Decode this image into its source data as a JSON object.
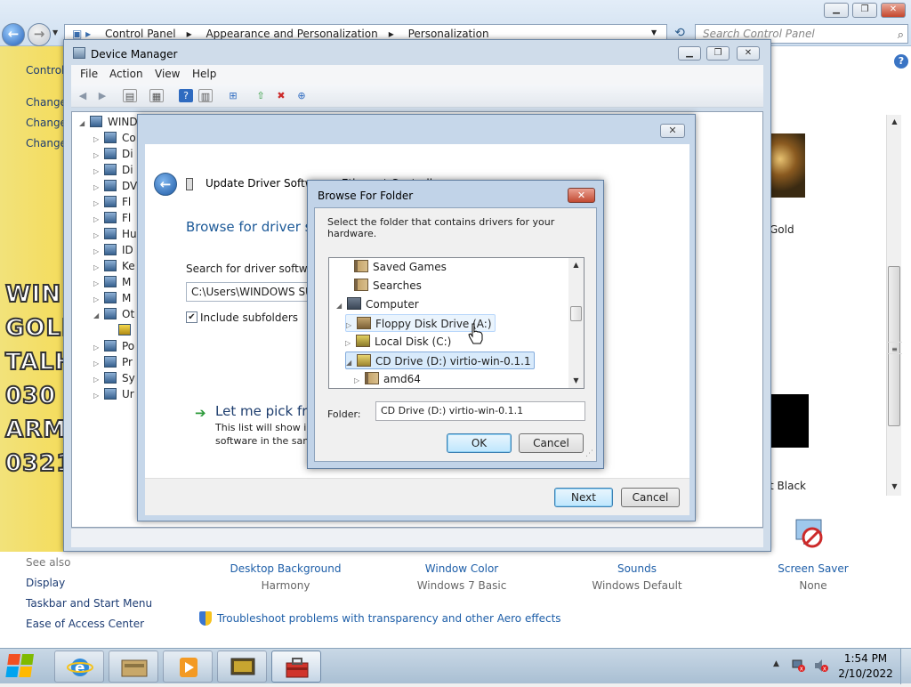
{
  "control_panel": {
    "breadcrumb": [
      "Control Panel",
      "Appearance and Personalization",
      "Personalization"
    ],
    "search_placeholder": "Search Control Panel",
    "sidebar_links": [
      "Control",
      "Change",
      "Change",
      "Change"
    ],
    "see_also_title": "See also",
    "see_also_links": [
      "Display",
      "Taskbar and Start Menu",
      "Ease of Access Center"
    ],
    "logo_lines": [
      "WIN",
      "GOLD",
      "TALH",
      "030",
      "ARM",
      "0321"
    ],
    "themes": {
      "gold_label": "Gold",
      "black_label": "t Black"
    },
    "items": [
      {
        "title": "Desktop Background",
        "subtitle": "Harmony"
      },
      {
        "title": "Window Color",
        "subtitle": "Windows 7 Basic"
      },
      {
        "title": "Sounds",
        "subtitle": "Windows Default"
      },
      {
        "title": "Screen Saver",
        "subtitle": "None"
      }
    ],
    "troubleshoot_link": "Troubleshoot problems with transparency and other Aero effects"
  },
  "device_manager": {
    "title": "Device Manager",
    "menu": [
      "File",
      "Action",
      "View",
      "Help"
    ],
    "tree_root": "WIND",
    "tree_items": [
      "Co",
      "Di",
      "Di",
      "DV",
      "Fl",
      "Fl",
      "Hu",
      "ID",
      "Ke",
      "M",
      "M",
      "Ot",
      "",
      "Po",
      "Pr",
      "Sy",
      "Ur"
    ]
  },
  "update_driver": {
    "title": "Update Driver Software - Ethernet Controller",
    "heading": "Browse for driver sof",
    "search_label": "Search for driver software in",
    "path_value": "C:\\Users\\WINDOWS SUKS\\",
    "include_subfolders": "Include subfolders",
    "include_subfolders_checked": true,
    "pick_heading": "Let me pick from",
    "pick_desc_1": "This list will show inst",
    "pick_desc_2": "software in the same",
    "next_label": "Next",
    "cancel_label": "Cancel"
  },
  "browse_folder": {
    "title": "Browse For Folder",
    "instruction": "Select the folder that contains drivers for your hardware.",
    "tree": [
      {
        "label": "Saved Games",
        "state": "normal"
      },
      {
        "label": "Searches",
        "state": "normal"
      },
      {
        "label": "Computer",
        "state": "expanded"
      },
      {
        "label": "Floppy Disk Drive (A:)",
        "state": "hover"
      },
      {
        "label": "Local Disk (C:)",
        "state": "collapsed"
      },
      {
        "label": "CD Drive (D:) virtio-win-0.1.1",
        "state": "selected"
      },
      {
        "label": "amd64",
        "state": "collapsed"
      }
    ],
    "folder_label": "Folder:",
    "folder_value": "CD Drive (D:) virtio-win-0.1.1",
    "ok_label": "OK",
    "cancel_label": "Cancel"
  },
  "taskbar": {
    "time": "1:54 PM",
    "date": "2/10/2022",
    "apps": [
      "internet-explorer",
      "file-manager",
      "media-player",
      "control-panel",
      "toolbox"
    ]
  },
  "colors": {
    "accent_link": "#1d5ea8",
    "sidebar_gold": "#f5d94d",
    "close_red": "#c24a32"
  }
}
